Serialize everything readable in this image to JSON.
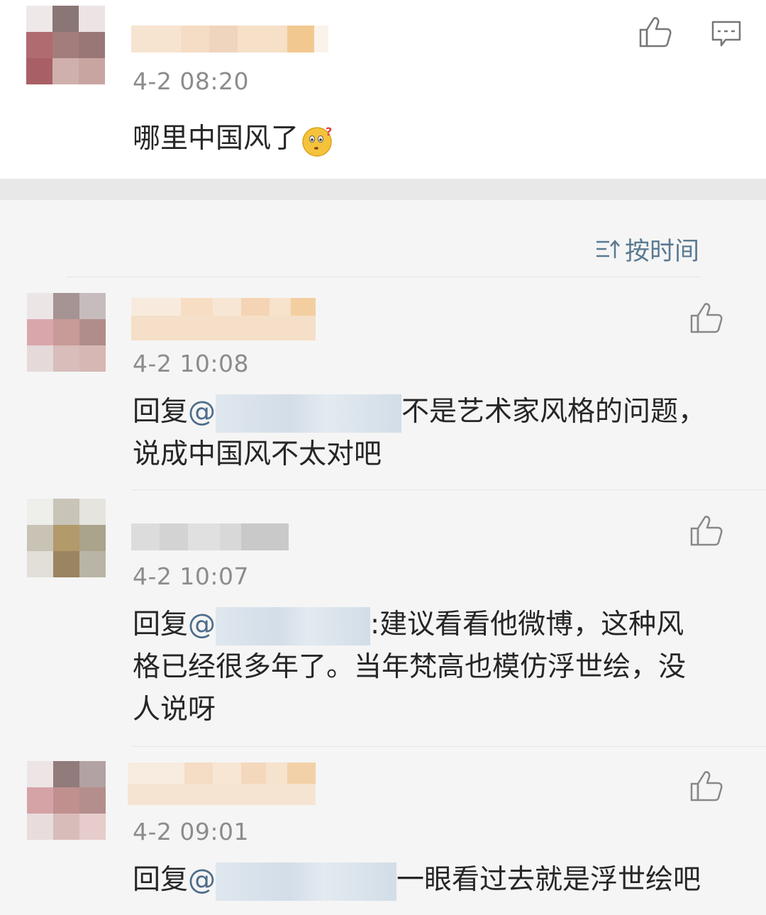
{
  "post": {
    "time": "4-2 08:20",
    "text": "哪里中国风了",
    "emoji": "thinking-face-emoji"
  },
  "sort": {
    "label": "按时间"
  },
  "replies": [
    {
      "time": "4-2 10:08",
      "prefix": "回复",
      "at": "@",
      "text_line1": "不是艺术家风格的问题，",
      "text_line2": "说成中国风不太对吧"
    },
    {
      "time": "4-2 10:07",
      "prefix": "回复",
      "at": "@",
      "text_line1": ":建议看看他微博，这种风",
      "text_line2": "格已经很多年了。当年梵高也模仿浮世绘，没",
      "text_line3": "人说呀"
    },
    {
      "time": "4-2 09:01",
      "prefix": "回复",
      "at": "@",
      "text_line1": "一眼看过去就是浮世绘吧"
    }
  ],
  "colors": {
    "mention": "#4d6d8a",
    "time": "#8c8c8c",
    "sort": "#5a7a92"
  }
}
